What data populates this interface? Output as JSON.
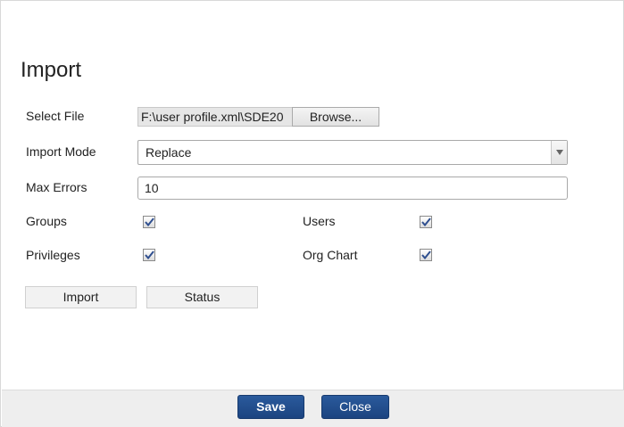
{
  "dialog": {
    "title": "Import"
  },
  "form": {
    "select_file": {
      "label": "Select File",
      "value": "F:\\user profile.xml\\SDE20",
      "browse_label": "Browse..."
    },
    "import_mode": {
      "label": "Import Mode",
      "selected": "Replace"
    },
    "max_errors": {
      "label": "Max Errors",
      "value": "10"
    },
    "options": {
      "groups": {
        "label": "Groups",
        "checked": true
      },
      "users": {
        "label": "Users",
        "checked": true
      },
      "privileges": {
        "label": "Privileges",
        "checked": true
      },
      "org_chart": {
        "label": "Org Chart",
        "checked": true
      }
    }
  },
  "actions": {
    "import_label": "Import",
    "status_label": "Status"
  },
  "footer": {
    "save_label": "Save",
    "close_label": "Close"
  },
  "colors": {
    "primary_button": "#1f4a8a",
    "checkmark": "#2f4f8f"
  },
  "icons": {
    "select_arrow": "chevron-down-icon",
    "checkbox_mark": "checkmark-icon"
  }
}
